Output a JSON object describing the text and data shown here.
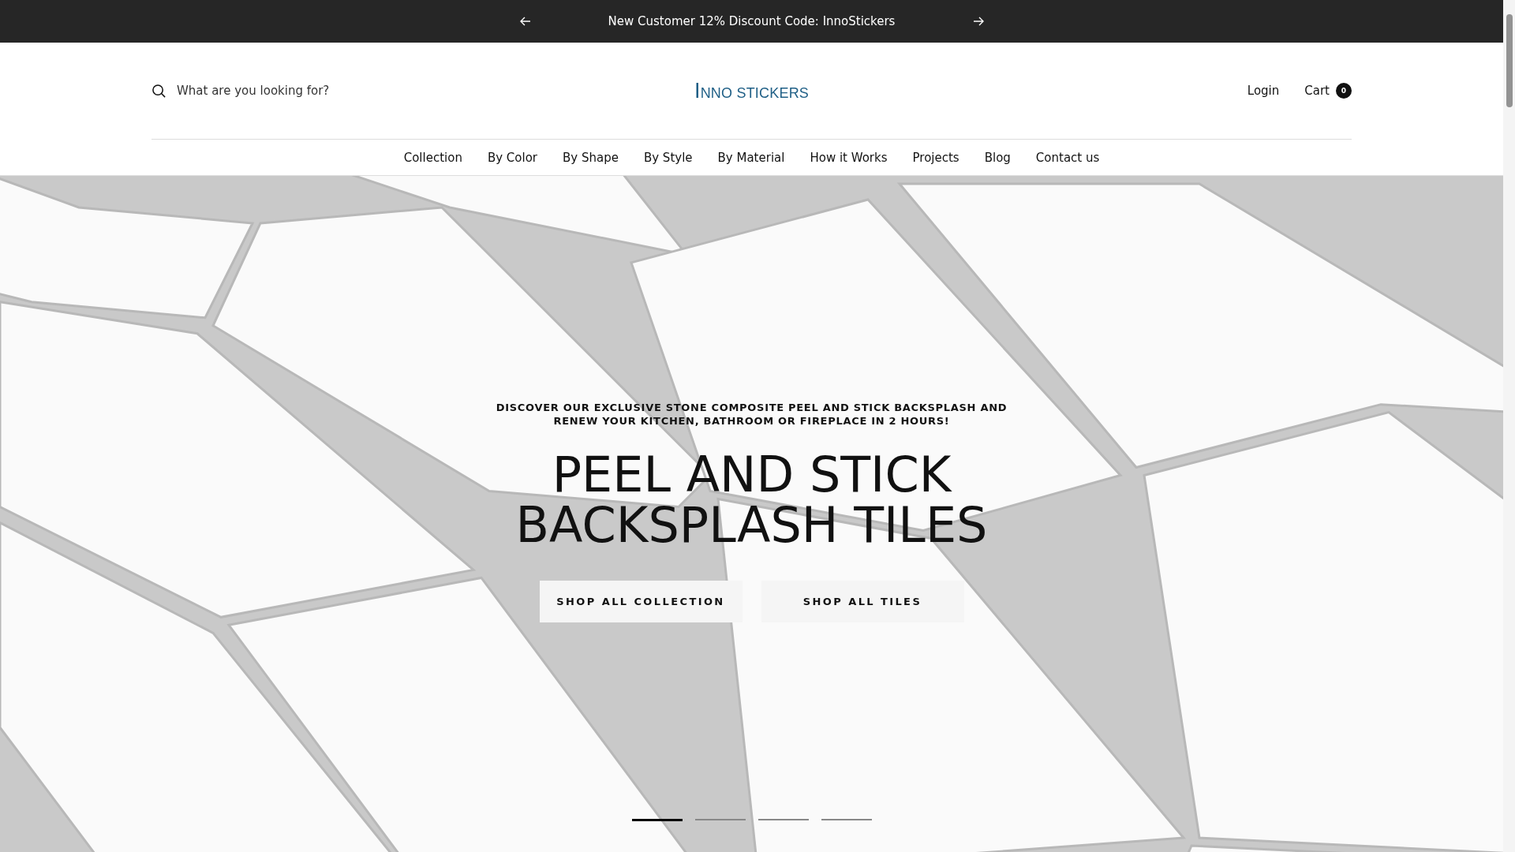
{
  "announcement": {
    "text": "New Customer 12% Discount Code: InnoStickers"
  },
  "header": {
    "search": {
      "placeholder": "What are you looking for?"
    },
    "logo": "INNO STICKERS",
    "login": "Login",
    "cart": {
      "label": "Cart",
      "count": "0"
    }
  },
  "nav": [
    {
      "label": "Collection"
    },
    {
      "label": "By Color"
    },
    {
      "label": "By Shape"
    },
    {
      "label": "By Style"
    },
    {
      "label": "By Material"
    },
    {
      "label": "How it Works"
    },
    {
      "label": "Projects"
    },
    {
      "label": "Blog"
    },
    {
      "label": "Contact us"
    }
  ],
  "hero": {
    "kind": "picture",
    "subtitle": "DISCOVER OUR EXCLUSIVE STONE COMPOSITE PEEL AND STICK BACKSPLASH AND RENEW YOUR KITCHEN, BATHROOM OR FIREPLACE IN 2 HOURS!",
    "title": "PEEL AND STICK BACKSPLASH TILES",
    "buttons": [
      "SHOP ALL COLLECTION",
      "SHOP ALL TILES"
    ],
    "slides": [
      {
        "selected": true
      },
      {
        "selected": false
      },
      {
        "selected": false
      },
      {
        "selected": false
      }
    ]
  }
}
